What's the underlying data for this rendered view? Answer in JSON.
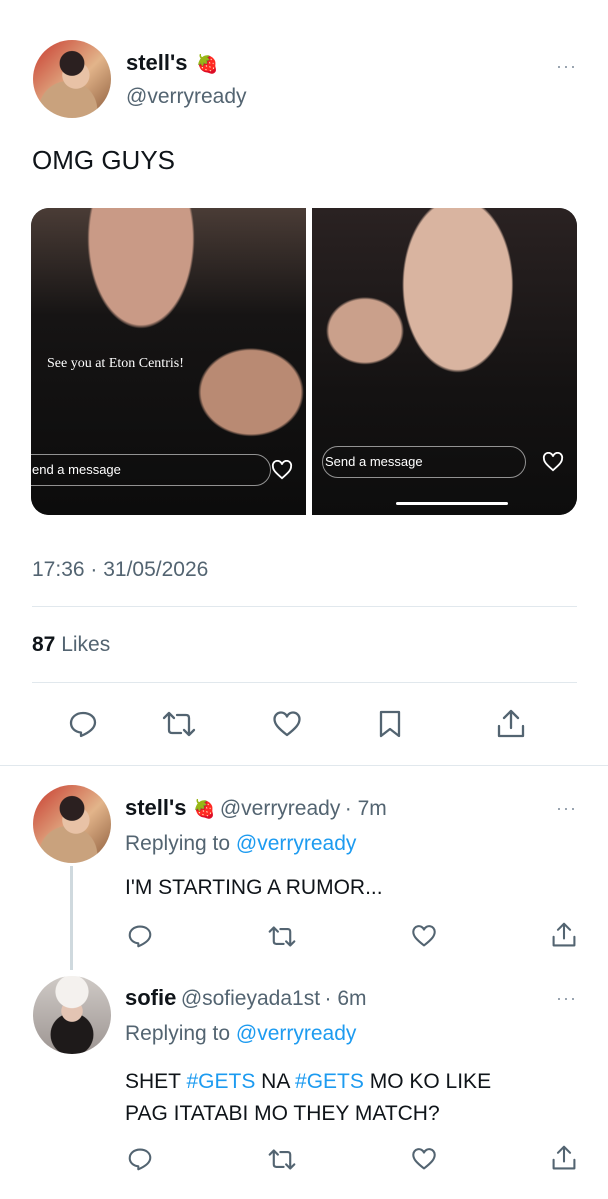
{
  "main_tweet": {
    "display_name": "stell's",
    "name_emoji": "🍓",
    "handle": "@verryready",
    "text": "OMG GUYS",
    "media": {
      "left_caption": "See you at Eton Centris!",
      "left_message_placeholder": "end a message",
      "right_message_placeholder": "Send a message"
    },
    "timestamp": "17:36 · 31/05/2026",
    "likes_count": "87",
    "likes_label": "Likes",
    "more_label": "···"
  },
  "replies": [
    {
      "display_name": "stell's",
      "name_emoji": "🍓",
      "handle": "@verryready",
      "time": "· 7m",
      "replying_prefix": "Replying to",
      "replying_handle": "@verryready",
      "text": "I'M STARTING A RUMOR...",
      "more_label": "···"
    },
    {
      "display_name": "sofie",
      "handle": "@sofieyada1st",
      "time": "· 6m",
      "replying_prefix": "Replying to",
      "replying_handle": "@verryready",
      "text_line1_prefix": "SHET ",
      "text_line1_tag1": "#GETS",
      "text_line1_mid": " NA ",
      "text_line1_tag2": "#GETS",
      "text_line1_suffix": " MO KO LIKE",
      "text_line2": "PAG ITATABI MO THEY MATCH?",
      "more_label": "···"
    }
  ],
  "colors": {
    "accent": "#1d9bf0",
    "muted": "#536471",
    "divider": "#e1e8ed"
  },
  "icons": [
    "reply-icon",
    "retweet-icon",
    "like-icon",
    "bookmark-icon",
    "share-icon",
    "strawberry-icon",
    "more-icon"
  ]
}
